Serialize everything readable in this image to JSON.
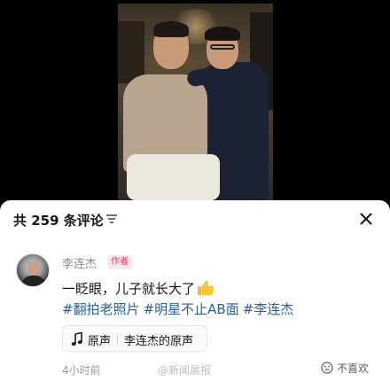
{
  "comments_sheet": {
    "title": "共 259 条评论",
    "sort_icon": "sort-lines-icon",
    "close_icon": "close-icon"
  },
  "comment": {
    "author": "李连杰",
    "author_badge": "作者",
    "text": "一眨眼，儿子就长大了",
    "emoji_icon": "thumbs-up-icon",
    "hashtags": [
      "#翻拍老照片",
      "#明星不止AB面",
      "#李连杰"
    ],
    "sound": {
      "label": "原声",
      "name": "李连杰的原声",
      "icon": "music-note-icon"
    },
    "time": "4小时前",
    "dislike_label": "不喜欢",
    "dislike_icon": "neutral-face-icon"
  },
  "watermark": "@新闻晨报",
  "colors": {
    "hashtag": "#2a5ea0",
    "badge_text": "#ff2d55",
    "badge_bg": "#fde8ec"
  }
}
